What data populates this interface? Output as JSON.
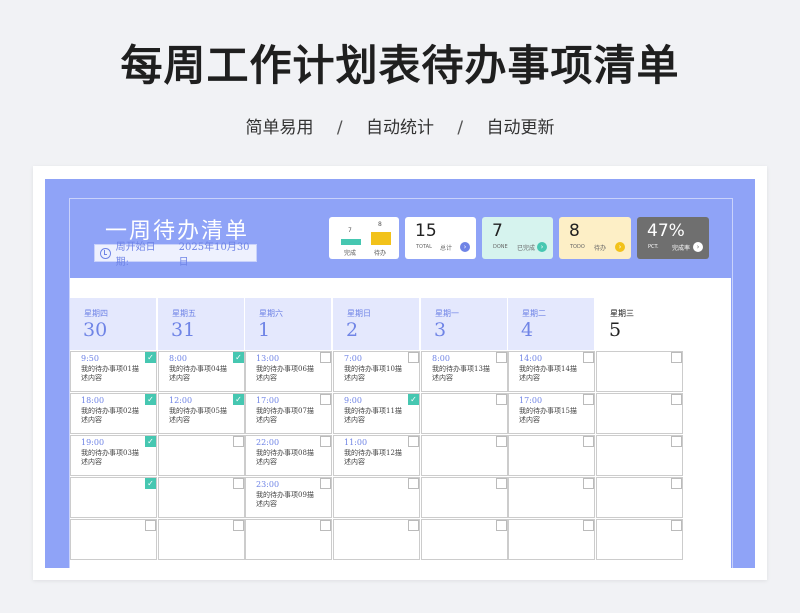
{
  "header": {
    "title": "每周工作计划表待办事项清单",
    "tags": [
      "简单易用",
      "自动统计",
      "自动更新"
    ],
    "separator": "/"
  },
  "sheet": {
    "title": "一周待办清单",
    "start_label": "周开始日期:",
    "start_date": "2025年10月30日"
  },
  "colors": {
    "accent": "#8fa3f7",
    "text_accent": "#6f84e6",
    "done_teal": "#46c7b1",
    "todo_yellow": "#f2c21a",
    "pct_gray": "#6f6f6f"
  },
  "mini_chart": {
    "bars": [
      {
        "label": "完成",
        "value": "7",
        "color": "#46c7b1"
      },
      {
        "label": "待办",
        "value": "8",
        "color": "#f2c21a"
      }
    ]
  },
  "stats": {
    "total": {
      "value": "15",
      "caption": "TOTAL",
      "label": "总计",
      "icon": "arrow-right-icon"
    },
    "done": {
      "value": "7",
      "caption": "DONE",
      "label": "已完成",
      "icon": "arrow-right-icon"
    },
    "todo": {
      "value": "8",
      "caption": "TODO",
      "label": "待办",
      "icon": "arrow-right-icon"
    },
    "pct": {
      "value": "47%",
      "caption": "PCT.",
      "label": "完成率",
      "icon": "arrow-right-icon"
    }
  },
  "days": [
    {
      "weekday": "星期四",
      "date": "30",
      "tasks": [
        {
          "time": "9:50",
          "desc": "我的待办事项01描述内容",
          "done": true
        },
        {
          "time": "18:00",
          "desc": "我的待办事项02描述内容",
          "done": true
        },
        {
          "time": "19:00",
          "desc": "我的待办事项03描述内容",
          "done": true
        },
        {
          "time": "",
          "desc": "",
          "done": true
        },
        {
          "time": "",
          "desc": "",
          "done": false
        }
      ]
    },
    {
      "weekday": "星期五",
      "date": "31",
      "tasks": [
        {
          "time": "8:00",
          "desc": "我的待办事项04描述内容",
          "done": true
        },
        {
          "time": "12:00",
          "desc": "我的待办事项05描述内容",
          "done": true
        },
        {
          "time": "",
          "desc": "",
          "done": false
        },
        {
          "time": "",
          "desc": "",
          "done": false
        },
        {
          "time": "",
          "desc": "",
          "done": false
        }
      ]
    },
    {
      "weekday": "星期六",
      "date": "1",
      "tasks": [
        {
          "time": "13:00",
          "desc": "我的待办事项06描述内容",
          "done": false
        },
        {
          "time": "17:00",
          "desc": "我的待办事项07描述内容",
          "done": false
        },
        {
          "time": "22:00",
          "desc": "我的待办事项08描述内容",
          "done": false
        },
        {
          "time": "23:00",
          "desc": "我的待办事项09描述内容",
          "done": false
        },
        {
          "time": "",
          "desc": "",
          "done": false
        }
      ]
    },
    {
      "weekday": "星期日",
      "date": "2",
      "tasks": [
        {
          "time": "7:00",
          "desc": "我的待办事项10描述内容",
          "done": false
        },
        {
          "time": "9:00",
          "desc": "我的待办事项11描述内容",
          "done": true
        },
        {
          "time": "11:00",
          "desc": "我的待办事项12描述内容",
          "done": false
        },
        {
          "time": "",
          "desc": "",
          "done": false
        },
        {
          "time": "",
          "desc": "",
          "done": false
        }
      ]
    },
    {
      "weekday": "星期一",
      "date": "3",
      "tasks": [
        {
          "time": "8:00",
          "desc": "我的待办事项13描述内容",
          "done": false
        },
        {
          "time": "",
          "desc": "",
          "done": false
        },
        {
          "time": "",
          "desc": "",
          "done": false
        },
        {
          "time": "",
          "desc": "",
          "done": false
        },
        {
          "time": "",
          "desc": "",
          "done": false
        }
      ]
    },
    {
      "weekday": "星期二",
      "date": "4",
      "tasks": [
        {
          "time": "14:00",
          "desc": "我的待办事项14描述内容",
          "done": false
        },
        {
          "time": "17:00",
          "desc": "我的待办事项15描述内容",
          "done": false
        },
        {
          "time": "",
          "desc": "",
          "done": false
        },
        {
          "time": "",
          "desc": "",
          "done": false
        },
        {
          "time": "",
          "desc": "",
          "done": false
        }
      ]
    },
    {
      "weekday": "星期三",
      "date": "5",
      "tasks": [
        {
          "time": "",
          "desc": "",
          "done": false
        },
        {
          "time": "",
          "desc": "",
          "done": false
        },
        {
          "time": "",
          "desc": "",
          "done": false
        },
        {
          "time": "",
          "desc": "",
          "done": false
        },
        {
          "time": "",
          "desc": "",
          "done": false
        }
      ]
    }
  ]
}
